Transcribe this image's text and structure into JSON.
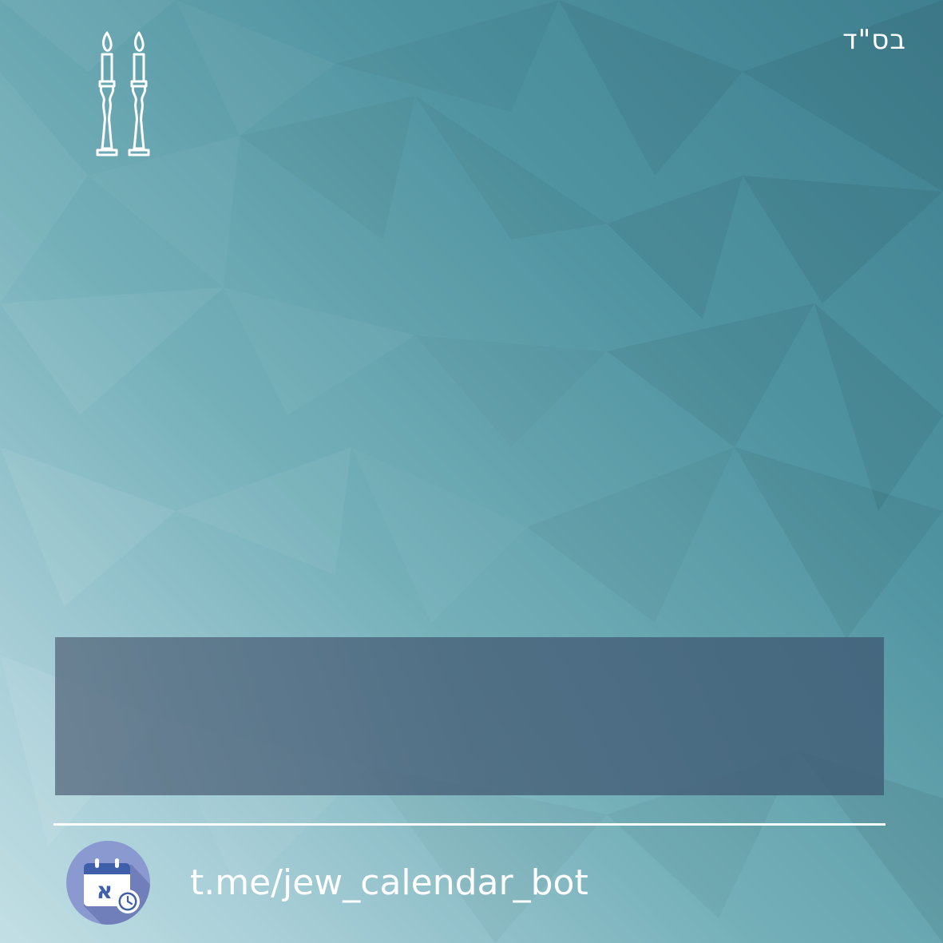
{
  "header": {
    "bsd_text": "בס\"ד"
  },
  "icons": {
    "candles": "shabbat-candles-icon",
    "logo": "hebrew-calendar-clock-icon",
    "logo_letter": "א"
  },
  "footer": {
    "link_text": "t.me/jew_calendar_bot"
  },
  "colors": {
    "background_top_right": "#3f7f8f",
    "background_bottom_left": "#c2dfe4",
    "panel": "#5a6e82",
    "logo_circle": "#8a9ad0",
    "logo_calendar_header": "#3f5faa",
    "text": "#ffffff"
  }
}
